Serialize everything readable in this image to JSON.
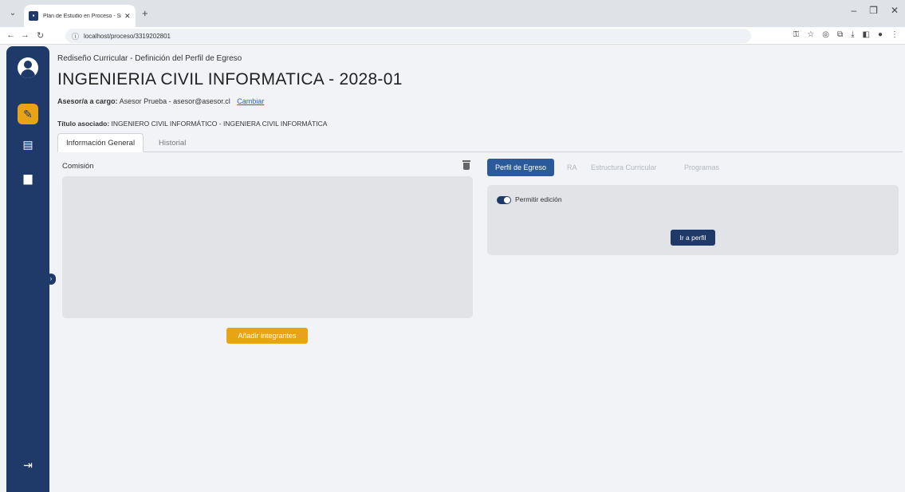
{
  "browser": {
    "tab_title": "Plan de Estudio en Proceso - Si",
    "tab_close": "✕",
    "new_tab": "+",
    "url": "localhost/proceso/3319202801",
    "window_controls": [
      "–",
      "❐",
      "✕"
    ]
  },
  "header": {
    "breadcrumb": "Rediseño Curricular - Definición del Perfil de Egreso",
    "title": "INGENIERIA CIVIL INFORMATICA - 2028-01",
    "advisor_label": "Asesor/a a cargo:",
    "advisor_value": "Asesor Prueba - asesor@asesor.cl",
    "advisor_change_link": "Cambiar",
    "degree_label": "Título asociado:",
    "degree_value": "INGENIERO CIVIL INFORMÁTICO - INGENIERA CIVIL INFORMÁTICA"
  },
  "tabs": [
    {
      "label": "Información General",
      "active": true
    },
    {
      "label": "Historial",
      "active": false
    }
  ],
  "commission": {
    "label": "Comisión",
    "add_button": "Añadir integrantes"
  },
  "right_tabs": [
    {
      "label": "Perfil de Egreso",
      "active": true
    },
    {
      "label": "RA",
      "active": false
    },
    {
      "label": "Estructura Curricular",
      "active": false
    },
    {
      "label": "Programas",
      "active": false
    }
  ],
  "profile_panel": {
    "toggle_label": "Permitir edición",
    "toggle_on": true,
    "go_button": "Ir a perfil"
  },
  "colors": {
    "sidebar": "#1f3a68",
    "accent": "#e8a317",
    "primary_button": "#2b5a9b"
  }
}
